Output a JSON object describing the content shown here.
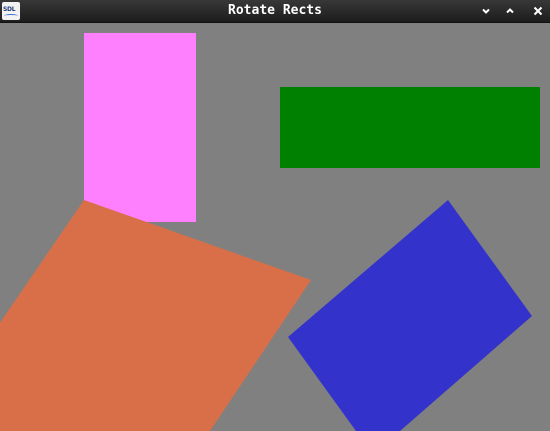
{
  "window": {
    "title": "Rotate Rects",
    "app_icon_text": "SDL",
    "background_color": "#808080"
  },
  "controls": {
    "minimize_icon": "chevron-down-icon",
    "maximize_icon": "chevron-up-icon",
    "close_icon": "close-icon"
  },
  "scene": {
    "rectangles": [
      {
        "name": "pink-rect",
        "color": "#ff80ff"
      },
      {
        "name": "green-rect",
        "color": "#008000"
      },
      {
        "name": "orange-rect",
        "color": "#d86f48"
      },
      {
        "name": "blue-rect",
        "color": "#3333cc"
      }
    ]
  }
}
